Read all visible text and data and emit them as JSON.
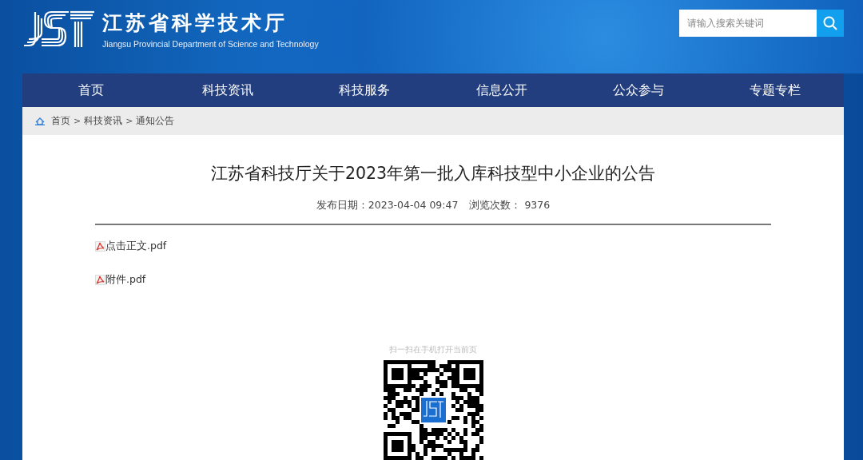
{
  "header": {
    "title": "江苏省科学技术厅",
    "subtitle": "Jiangsu Provincial Department of Science and Technology",
    "search": {
      "placeholder": "请输入搜索关键词"
    }
  },
  "nav": [
    "首页",
    "科技资讯",
    "科技服务",
    "信息公开",
    "公众参与",
    "专题专栏"
  ],
  "breadcrumb": [
    "首页",
    "科技资讯",
    "通知公告"
  ],
  "breadcrumb_separator": ">",
  "article": {
    "title": "江苏省科技厅关于2023年第一批入库科技型中小企业的公告",
    "date": "发布日期：2023-04-04 09:47",
    "views": "浏览次数： 9376",
    "attachments": [
      "点击正文.pdf",
      "附件.pdf"
    ],
    "qr_caption": "扫一扫在手机打开当前页"
  }
}
